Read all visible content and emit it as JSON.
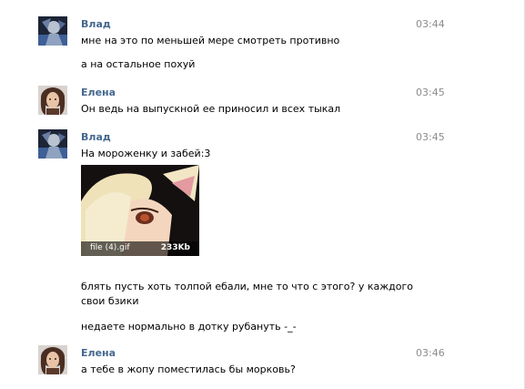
{
  "messages": [
    {
      "author": "Влад",
      "time": "03:44",
      "avatar": "vlad-avatar-icon",
      "lines": [
        "мне на это по меньшей мере смотреть противно",
        "а на остальное похуй"
      ]
    },
    {
      "author": "Елена",
      "time": "03:45",
      "avatar": "elena-avatar-icon",
      "lines": [
        "Он ведь на выпускной ее приносил и всех тыкал"
      ]
    },
    {
      "author": "Влад",
      "time": "03:45",
      "avatar": "vlad-avatar-icon",
      "lines": [
        "На мороженку и забей:3",
        "блять пусть хоть толпой ебали, мне то что с этого? у каждого свои бзики",
        "недаете нормально в дотку рубануть -_-"
      ],
      "attachment": {
        "filename": "file (4).gif",
        "size": "233Kb"
      }
    },
    {
      "author": "Елена",
      "time": "03:46",
      "avatar": "elena-avatar-icon",
      "lines": [
        "а тебе в жопу поместилась бы морковь?"
      ]
    }
  ],
  "colors": {
    "author": "#45688e",
    "time": "#8c8c8c",
    "text": "#000000"
  }
}
